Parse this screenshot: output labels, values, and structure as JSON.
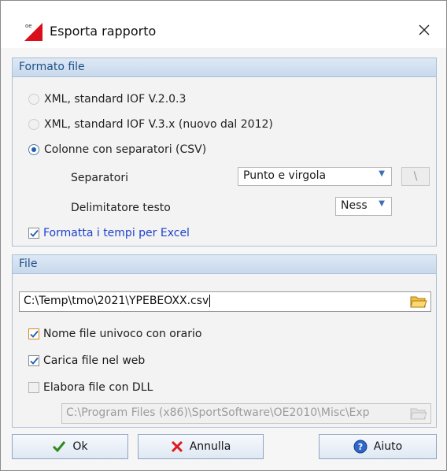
{
  "window": {
    "title": "Esporta rapporto"
  },
  "format_group": {
    "header": "Formato file",
    "options": [
      {
        "label": "XML, standard IOF V.2.0.3",
        "selected": false
      },
      {
        "label": "XML, standard IOF V.3.x (nuovo dal 2012)",
        "selected": false
      },
      {
        "label": "Colonne con separatori (CSV)",
        "selected": true
      }
    ],
    "separator_label": "Separatori",
    "separator_value": "Punto e virgola",
    "separator_char": "\\",
    "delimiter_label": "Delimitatore testo",
    "delimiter_value": "Ness",
    "excel_checkbox_label": "Formatta i tempi per Excel"
  },
  "file_group": {
    "header": "File",
    "path_value": "C:\\Temp\\tmo\\2021\\YPEBEOXX.csv",
    "unique_name_label": "Nome file univoco con orario",
    "upload_web_label": "Carica file nel web",
    "dll_label": "Elabora file con DLL",
    "dll_path_value": "C:\\Program Files (x86)\\SportSoftware\\OE2010\\Misc\\Exp"
  },
  "buttons": {
    "ok": "Ok",
    "cancel": "Annulla",
    "help": "Aiuto"
  },
  "colors": {
    "accent": "#1e5fb0",
    "header_text": "#1f4f86",
    "checkmark": "#1e5fb0",
    "cancel_x": "#e0191b",
    "ok_check": "#2e8b1e"
  }
}
